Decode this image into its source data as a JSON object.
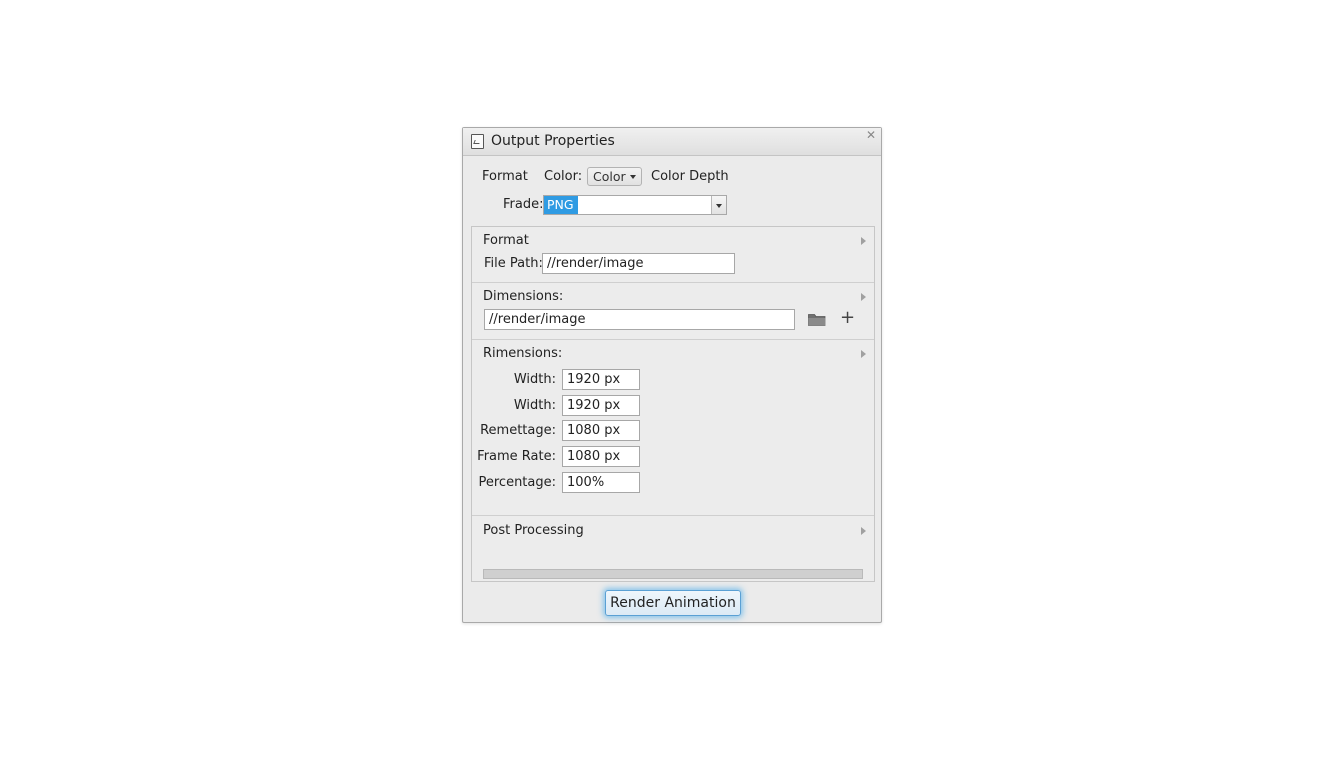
{
  "window": {
    "title": "Output Properties",
    "close_glyph": "✕"
  },
  "top": {
    "format_label": "Format",
    "color_label": "Color:",
    "color_select_value": "Color",
    "color_depth_label": "Color Depth",
    "frade_label": "Frade:",
    "frade_value": "PNG"
  },
  "sections": {
    "format": {
      "title": "Format",
      "file_path_label": "File Path:",
      "file_path_value": "//render/image"
    },
    "dimensions": {
      "title": "Dimensions:",
      "path_value": "//render/image"
    },
    "rimensions": {
      "title": "Rimensions:",
      "rows": [
        {
          "label": "Width:",
          "value": "1920 px"
        },
        {
          "label": "Width:",
          "value": "1920 px"
        },
        {
          "label": "Remettage:",
          "value": "1080 px"
        },
        {
          "label": "Frame Rate:",
          "value": "1080 px"
        },
        {
          "label": "Percentage:",
          "value": "100%"
        }
      ]
    },
    "post_processing": {
      "title": "Post Processing"
    }
  },
  "footer": {
    "render_label": "Render Animation"
  },
  "icons": {
    "plus": "+"
  },
  "colors": {
    "accent": "#2f9be3",
    "render_glow": "#46aaeb"
  }
}
